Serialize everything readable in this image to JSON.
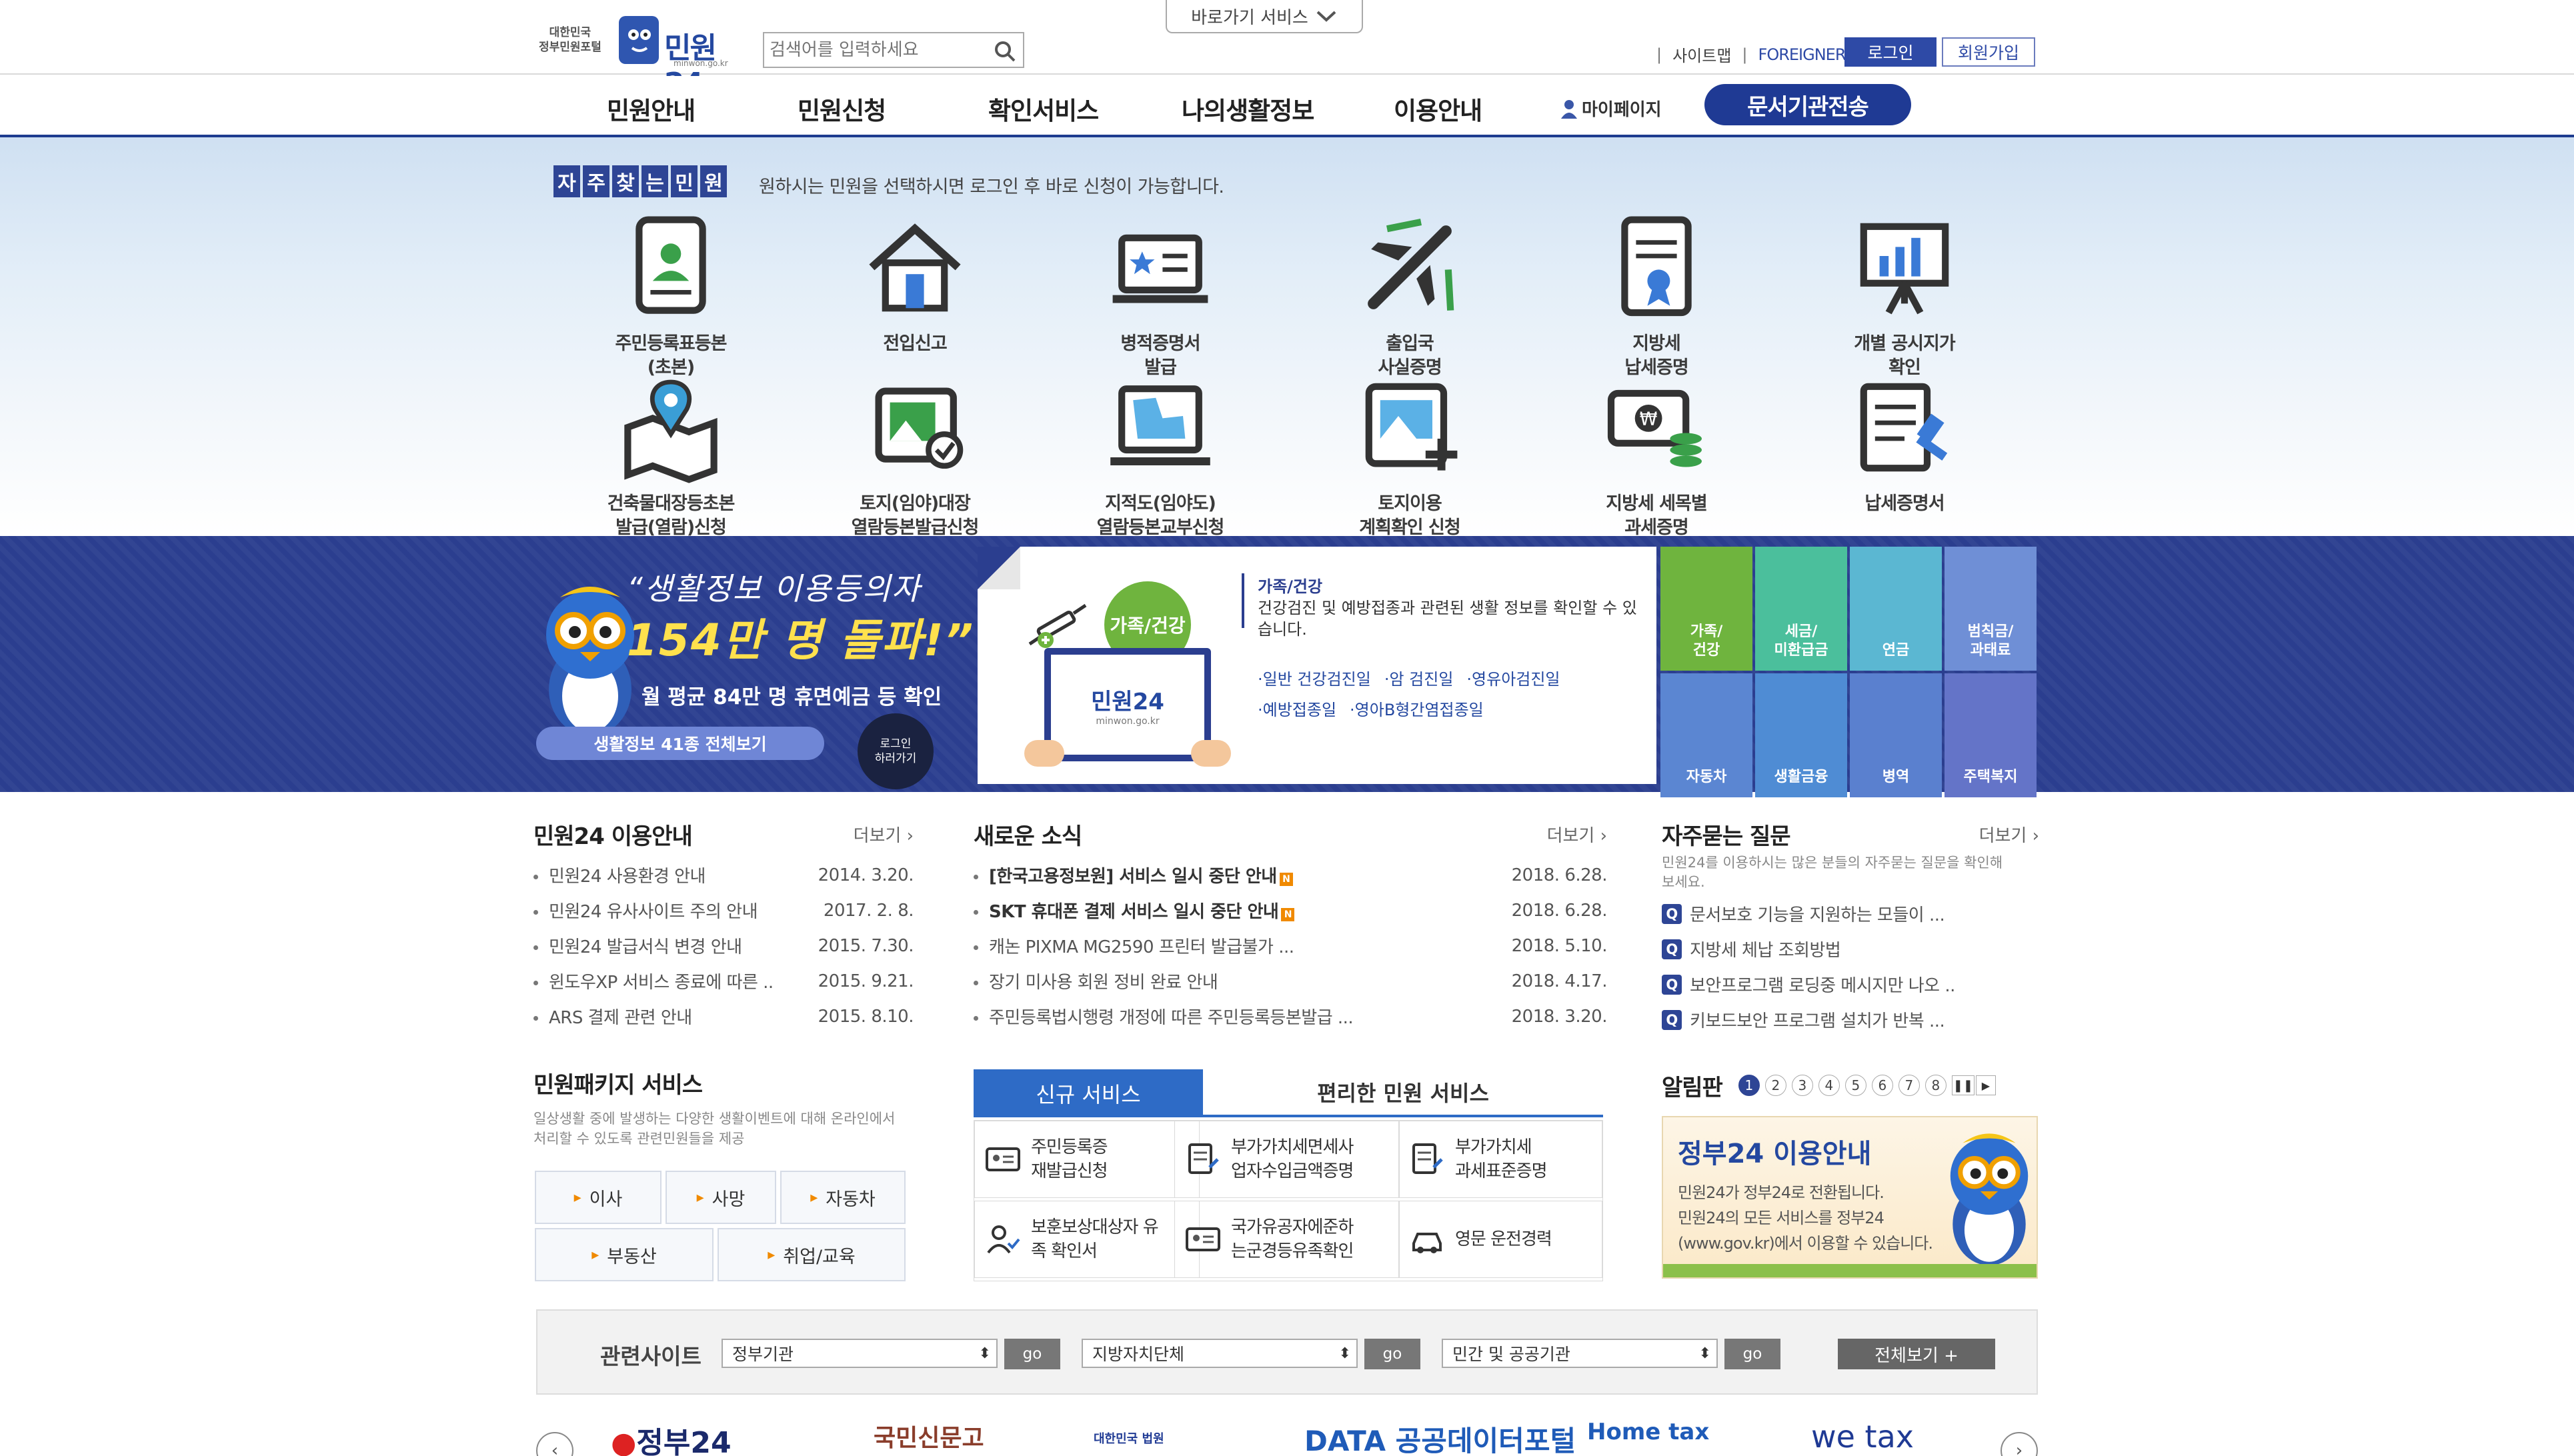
{
  "header": {
    "gov_label_1": "대한민국",
    "gov_label_2": "정부민원포털",
    "logo_text": "민원24",
    "logo_sub": "minwon.go.kr",
    "search_placeholder": "검색어를 입력하세요",
    "shortcut_label": "바로가기 서비스",
    "top_links": [
      "사이트맵",
      "FOREIGNER"
    ],
    "login": "로그인",
    "join": "회원가입"
  },
  "nav": {
    "items": [
      "민원안내",
      "민원신청",
      "확인서비스",
      "나의생활정보",
      "이용안내"
    ],
    "mypage": "마이페이지",
    "transfer": "문서기관전송"
  },
  "frequent": {
    "badge": [
      "자",
      "주",
      "찾",
      "는",
      "민",
      "원"
    ],
    "desc": "원하시는 민원을 선택하시면 로그인 후 바로 신청이 가능합니다.",
    "items": [
      {
        "label": "주민등록표등본\n(초본)",
        "icon": "id-card-icon"
      },
      {
        "label": "전입신고",
        "icon": "house-icon"
      },
      {
        "label": "병적증명서\n발급",
        "icon": "laptop-icon"
      },
      {
        "label": "출입국\n사실증명",
        "icon": "airplane-icon"
      },
      {
        "label": "지방세\n납세증명",
        "icon": "certificate-icon"
      },
      {
        "label": "개별 공시지가\n확인",
        "icon": "chart-board-icon"
      },
      {
        "label": "건축물대장등초본\n발급(열람)신청",
        "icon": "map-pin-icon"
      },
      {
        "label": "토지(임야)대장\n열람등본발급신청",
        "icon": "land-photo-icon"
      },
      {
        "label": "지적도(임야도)\n열람등본교부신청",
        "icon": "map-laptop-icon"
      },
      {
        "label": "토지이용\n계획확인 신청",
        "icon": "land-plan-icon"
      },
      {
        "label": "지방세 세목별\n과세증명",
        "icon": "money-icon"
      },
      {
        "label": "납세증명서",
        "icon": "stamp-doc-icon"
      }
    ]
  },
  "banner": {
    "quote1": "“생활정보 이용등의자",
    "quote2": "154만 명 돌파!”",
    "sub": "월 평균 84만 명 휴면예금 등 확인",
    "btn": "생활정보 41종 전체보기",
    "login_circle_1": "로그인",
    "login_circle_2": "하러가기",
    "circle_label": "가족/건강",
    "screen_logo": "민원24",
    "screen_sub": "minwon.go.kr",
    "info_title": "가족/건강",
    "info_desc": "건강검진 및 예방접종과 관련된 생활 정보를 확인할 수 있습니다.",
    "links": [
      "·일반 건강검진일",
      "·암 검진일",
      "·영유아검진일",
      "·예방접종일",
      "·영아B형간염접종일"
    ],
    "cats": [
      {
        "label": "가족/\n건강",
        "color": "#6fb43e"
      },
      {
        "label": "세금/\n미환급금",
        "color": "#4bbf9c"
      },
      {
        "label": "연금",
        "color": "#5bb7d2"
      },
      {
        "label": "범칙금/\n과태료",
        "color": "#6f8fd6"
      },
      {
        "label": "자동차",
        "color": "#5b86d2"
      },
      {
        "label": "생활금융",
        "color": "#4f8cd4"
      },
      {
        "label": "병역",
        "color": "#5a80cf"
      },
      {
        "label": "주택복지",
        "color": "#6474c8"
      }
    ]
  },
  "guide": {
    "title": "민원24 이용안내",
    "more": "더보기",
    "rows": [
      {
        "t": "민원24 사용환경 안내",
        "d": "2014. 3.20."
      },
      {
        "t": "민원24 유사사이트 주의 안내",
        "d": "2017. 2. 8."
      },
      {
        "t": "민원24 발급서식 변경 안내",
        "d": "2015. 7.30."
      },
      {
        "t": "윈도우XP 서비스 종료에 따른 ..",
        "d": "2015. 9.21."
      },
      {
        "t": "ARS 결제 관련 안내",
        "d": "2015. 8.10."
      }
    ]
  },
  "news": {
    "title": "새로운 소식",
    "more": "더보기",
    "new_badge": "N",
    "rows": [
      {
        "t": "[한국고용정보원] 서비스 일시 중단 안내",
        "d": "2018. 6.28.",
        "bold": true,
        "new": true
      },
      {
        "t": "SKT 휴대폰 결제 서비스 일시 중단 안내",
        "d": "2018. 6.28.",
        "bold": true,
        "new": true
      },
      {
        "t": "캐논 PIXMA MG2590 프린터 발급불가 ...",
        "d": "2018. 5.10.",
        "bold": false,
        "new": false
      },
      {
        "t": "장기 미사용 회원 정비 완료 안내",
        "d": "2018. 4.17.",
        "bold": false,
        "new": false
      },
      {
        "t": "주민등록법시행령 개정에 따른 주민등록등본발급 ...",
        "d": "2018. 3.20.",
        "bold": false,
        "new": false
      }
    ]
  },
  "faq": {
    "title": "자주묻는 질문",
    "more": "더보기",
    "desc": "민원24를 이용하시는 많은 분들의 자주묻는 질문을 확인해보세요.",
    "q": "Q",
    "rows": [
      "문서보호 기능을 지원하는 모들이 ...",
      "지방세 체납 조회방법",
      "보안프로그램 로딩중 메시지만 나오 ..",
      "키보드보안 프로그램 설치가 반복 ..."
    ]
  },
  "package": {
    "title": "민원패키지 서비스",
    "desc": "일상생활 중에 발생하는 다양한 생활이벤트에 대해 온라인에서 처리할 수 있도록 관련민원들을 제공",
    "items": [
      "이사",
      "사망",
      "자동차",
      "부동산",
      "취업/교육"
    ]
  },
  "services": {
    "tab_new": "신규 서비스",
    "tab_easy": "편리한 민원 서비스",
    "items": [
      "주민등록증\n재발급신청",
      "부가가치세면세사\n업자수입금액증명",
      "부가가치세\n과세표준증명",
      "보훈보상대상자 유\n족 확인서",
      "국가유공자에준하\n는군경등유족확인",
      "영문 운전경력"
    ]
  },
  "notice": {
    "title": "알림판",
    "pages": [
      "1",
      "2",
      "3",
      "4",
      "5",
      "6",
      "7",
      "8"
    ],
    "card_title": "정부24 이용안내",
    "card_text": [
      "민원24가 정부24로 전환됩니다.",
      "민원24의 모든 서비스를 정부24",
      "(www.gov.kr)에서 이용할 수 있습니다."
    ]
  },
  "related": {
    "title": "관련사이트",
    "selects": [
      "정부기관",
      "지방자치단체",
      "민간 및 공공기관"
    ],
    "go": "go",
    "all": "전체보기 +"
  },
  "footer_logos": [
    "정부24",
    "국민신문고",
    "대한민국 법원",
    "DATA 공공데이터포털",
    "Home tax",
    "we tax"
  ]
}
